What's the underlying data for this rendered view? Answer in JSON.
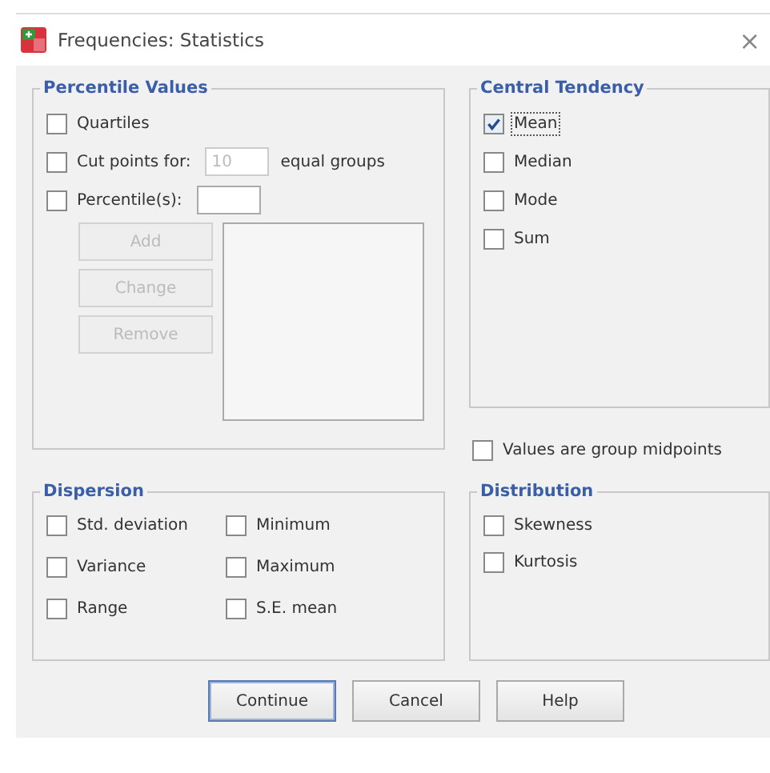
{
  "window": {
    "title": "Frequencies: Statistics",
    "close": "×"
  },
  "percentile_values": {
    "title": "Percentile Values",
    "quartiles": {
      "label": "Quartiles",
      "checked": false
    },
    "cut_points": {
      "label": "Cut points for:",
      "checked": false,
      "value": "10",
      "disabled": true,
      "suffix": "equal groups"
    },
    "percentiles": {
      "label": "Percentile(s):",
      "checked": false
    },
    "buttons": [
      {
        "label": "Add",
        "disabled": true
      },
      {
        "label": "Change",
        "disabled": true
      },
      {
        "label": "Remove",
        "disabled": true
      }
    ]
  },
  "central_tendency": {
    "title": "Central Tendency",
    "items": [
      {
        "label": "Mean",
        "checked": true,
        "focused": true
      },
      {
        "label": "Median",
        "checked": false,
        "focused": false
      },
      {
        "label": "Mode",
        "checked": false,
        "focused": false
      },
      {
        "label": "Sum",
        "checked": false,
        "focused": false
      }
    ]
  },
  "group_midpoints": {
    "label": "Values are group midpoints",
    "checked": false
  },
  "dispersion": {
    "title": "Dispersion",
    "items": [
      {
        "label": "Std. deviation",
        "checked": false
      },
      {
        "label": "Minimum",
        "checked": false
      },
      {
        "label": "Variance",
        "checked": false
      },
      {
        "label": "Maximum",
        "checked": false
      },
      {
        "label": "Range",
        "checked": false
      },
      {
        "label": "S.E. mean",
        "checked": false
      }
    ]
  },
  "distribution": {
    "title": "Distribution",
    "items": [
      {
        "label": "Skewness",
        "checked": false
      },
      {
        "label": "Kurtosis",
        "checked": false
      }
    ]
  },
  "buttons": [
    {
      "label": "Continue",
      "default": true
    },
    {
      "label": "Cancel",
      "default": false
    },
    {
      "label": "Help",
      "default": false
    }
  ]
}
